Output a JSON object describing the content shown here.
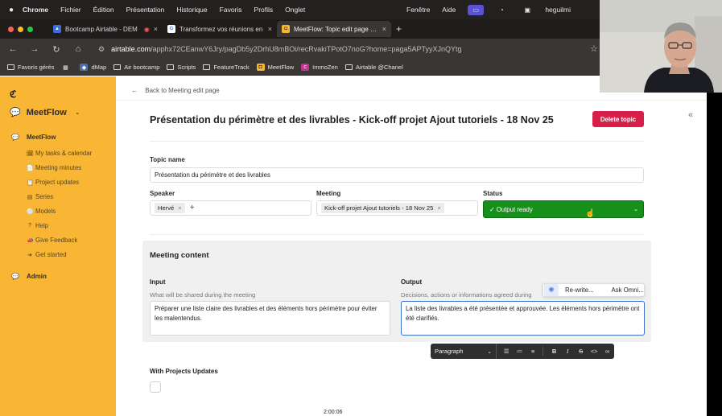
{
  "menubar": {
    "app": "Chrome",
    "items": [
      "Fichier",
      "Édition",
      "Présentation",
      "Historique",
      "Favoris",
      "Profils",
      "Onglet"
    ],
    "right_items": [
      "Fenêtre",
      "Aide"
    ],
    "user": "heguilmi"
  },
  "tabs": [
    {
      "title": "Bootcamp Airtable - DEM",
      "favicon_color": "#3a6fd8"
    },
    {
      "title": "Transformez vos réunions en",
      "favicon_color": "#ffffff"
    },
    {
      "title": "MeetFlow: Topic edit page - A",
      "favicon_color": "#f8b634"
    }
  ],
  "address": {
    "host": "airtable.com",
    "path": "/apphx72CEanwY6Jry/pagDb5y2DrhU8mBOi/recRvakiTPotO7noG?home=paga5APTyyXJnQYtg"
  },
  "bookmarks": [
    "Favoris gérés",
    "dMap",
    "Air bootcamp",
    "Scripts",
    "FeatureTrack",
    "MeetFlow",
    "ImmoZen",
    "Airtable @Chanel"
  ],
  "sidebar": {
    "logo": "ℭ",
    "app_name": "MeetFlow",
    "section": "MeetFlow",
    "items": [
      {
        "label": "My tasks & calendar",
        "icon": "calendar-icon"
      },
      {
        "label": "Meeting minutes",
        "icon": "document-icon"
      },
      {
        "label": "Project updates",
        "icon": "clipboard-icon"
      },
      {
        "label": "Series",
        "icon": "stack-icon"
      },
      {
        "label": "Models",
        "icon": "model-icon"
      },
      {
        "label": "Help",
        "icon": "help-icon"
      },
      {
        "label": "Give Feedback",
        "icon": "feedback-icon"
      },
      {
        "label": "Get started",
        "icon": "arrow-icon"
      }
    ],
    "admin": "Admin"
  },
  "main": {
    "back_link": "Back to Meeting edit page",
    "title": "Présentation du périmètre et des livrables - Kick-off projet Ajout tutoriels - 18 Nov 25",
    "delete_button": "Delete topic",
    "topic_name_label": "Topic name",
    "topic_name_value": "Présentation du périmètre et des livrables",
    "speaker_label": "Speaker",
    "speaker_value": "Hervé",
    "meeting_label": "Meeting",
    "meeting_value": "Kick-off projet Ajout tutoriels - 18 Nov 25",
    "status_label": "Status",
    "status_value": "✓ Output ready",
    "status_color": "#16901b"
  },
  "content": {
    "title": "Meeting content",
    "input_label": "Input",
    "input_help": "What will be shared during the meeting",
    "input_value": "Préparer une liste claire des livrables et des éléments hors périmètre pour éviter les malentendus.",
    "output_label": "Output",
    "output_help": "Decisions, actions or informations agreed during",
    "output_value": "La liste des livrables a été présentée et approuvée. Les éléments hors périmètre ont été clarifiés.",
    "ai_rewrite": "Re-write...",
    "ai_ask": "Ask Omni..."
  },
  "toolbar": {
    "format": "Paragraph"
  },
  "projects": {
    "label": "With Projects Updates"
  },
  "video": {
    "timestamp": "2:00:06"
  }
}
